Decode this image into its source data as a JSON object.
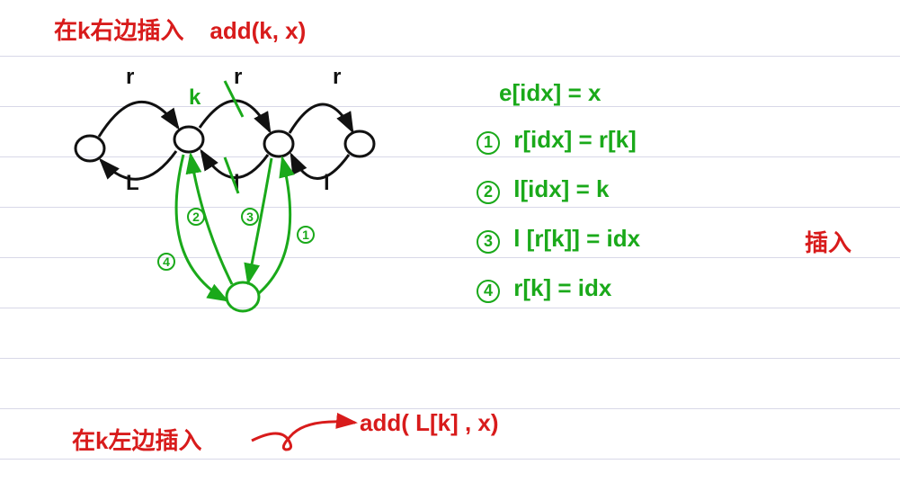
{
  "title_red": "在k右边插入",
  "title_red_func": "add(k, x)",
  "side_red": "插入",
  "bottom_red": "在k左边插入",
  "bottom_red_func": "add( L[k] , x)",
  "steps": {
    "s0": "e[idx] = x",
    "s1": "r[idx] = r[k]",
    "s2": "l[idx] = k",
    "s3": "l [r[k]] = idx",
    "s4": "r[k] = idx"
  },
  "node_labels": {
    "r1": "r",
    "r2": "r",
    "r3": "r",
    "l1": "L",
    "l2": "l",
    "l3": "l",
    "k": "k"
  },
  "step_nums": {
    "n1": "1",
    "n2": "2",
    "n3": "3",
    "n4": "4"
  }
}
